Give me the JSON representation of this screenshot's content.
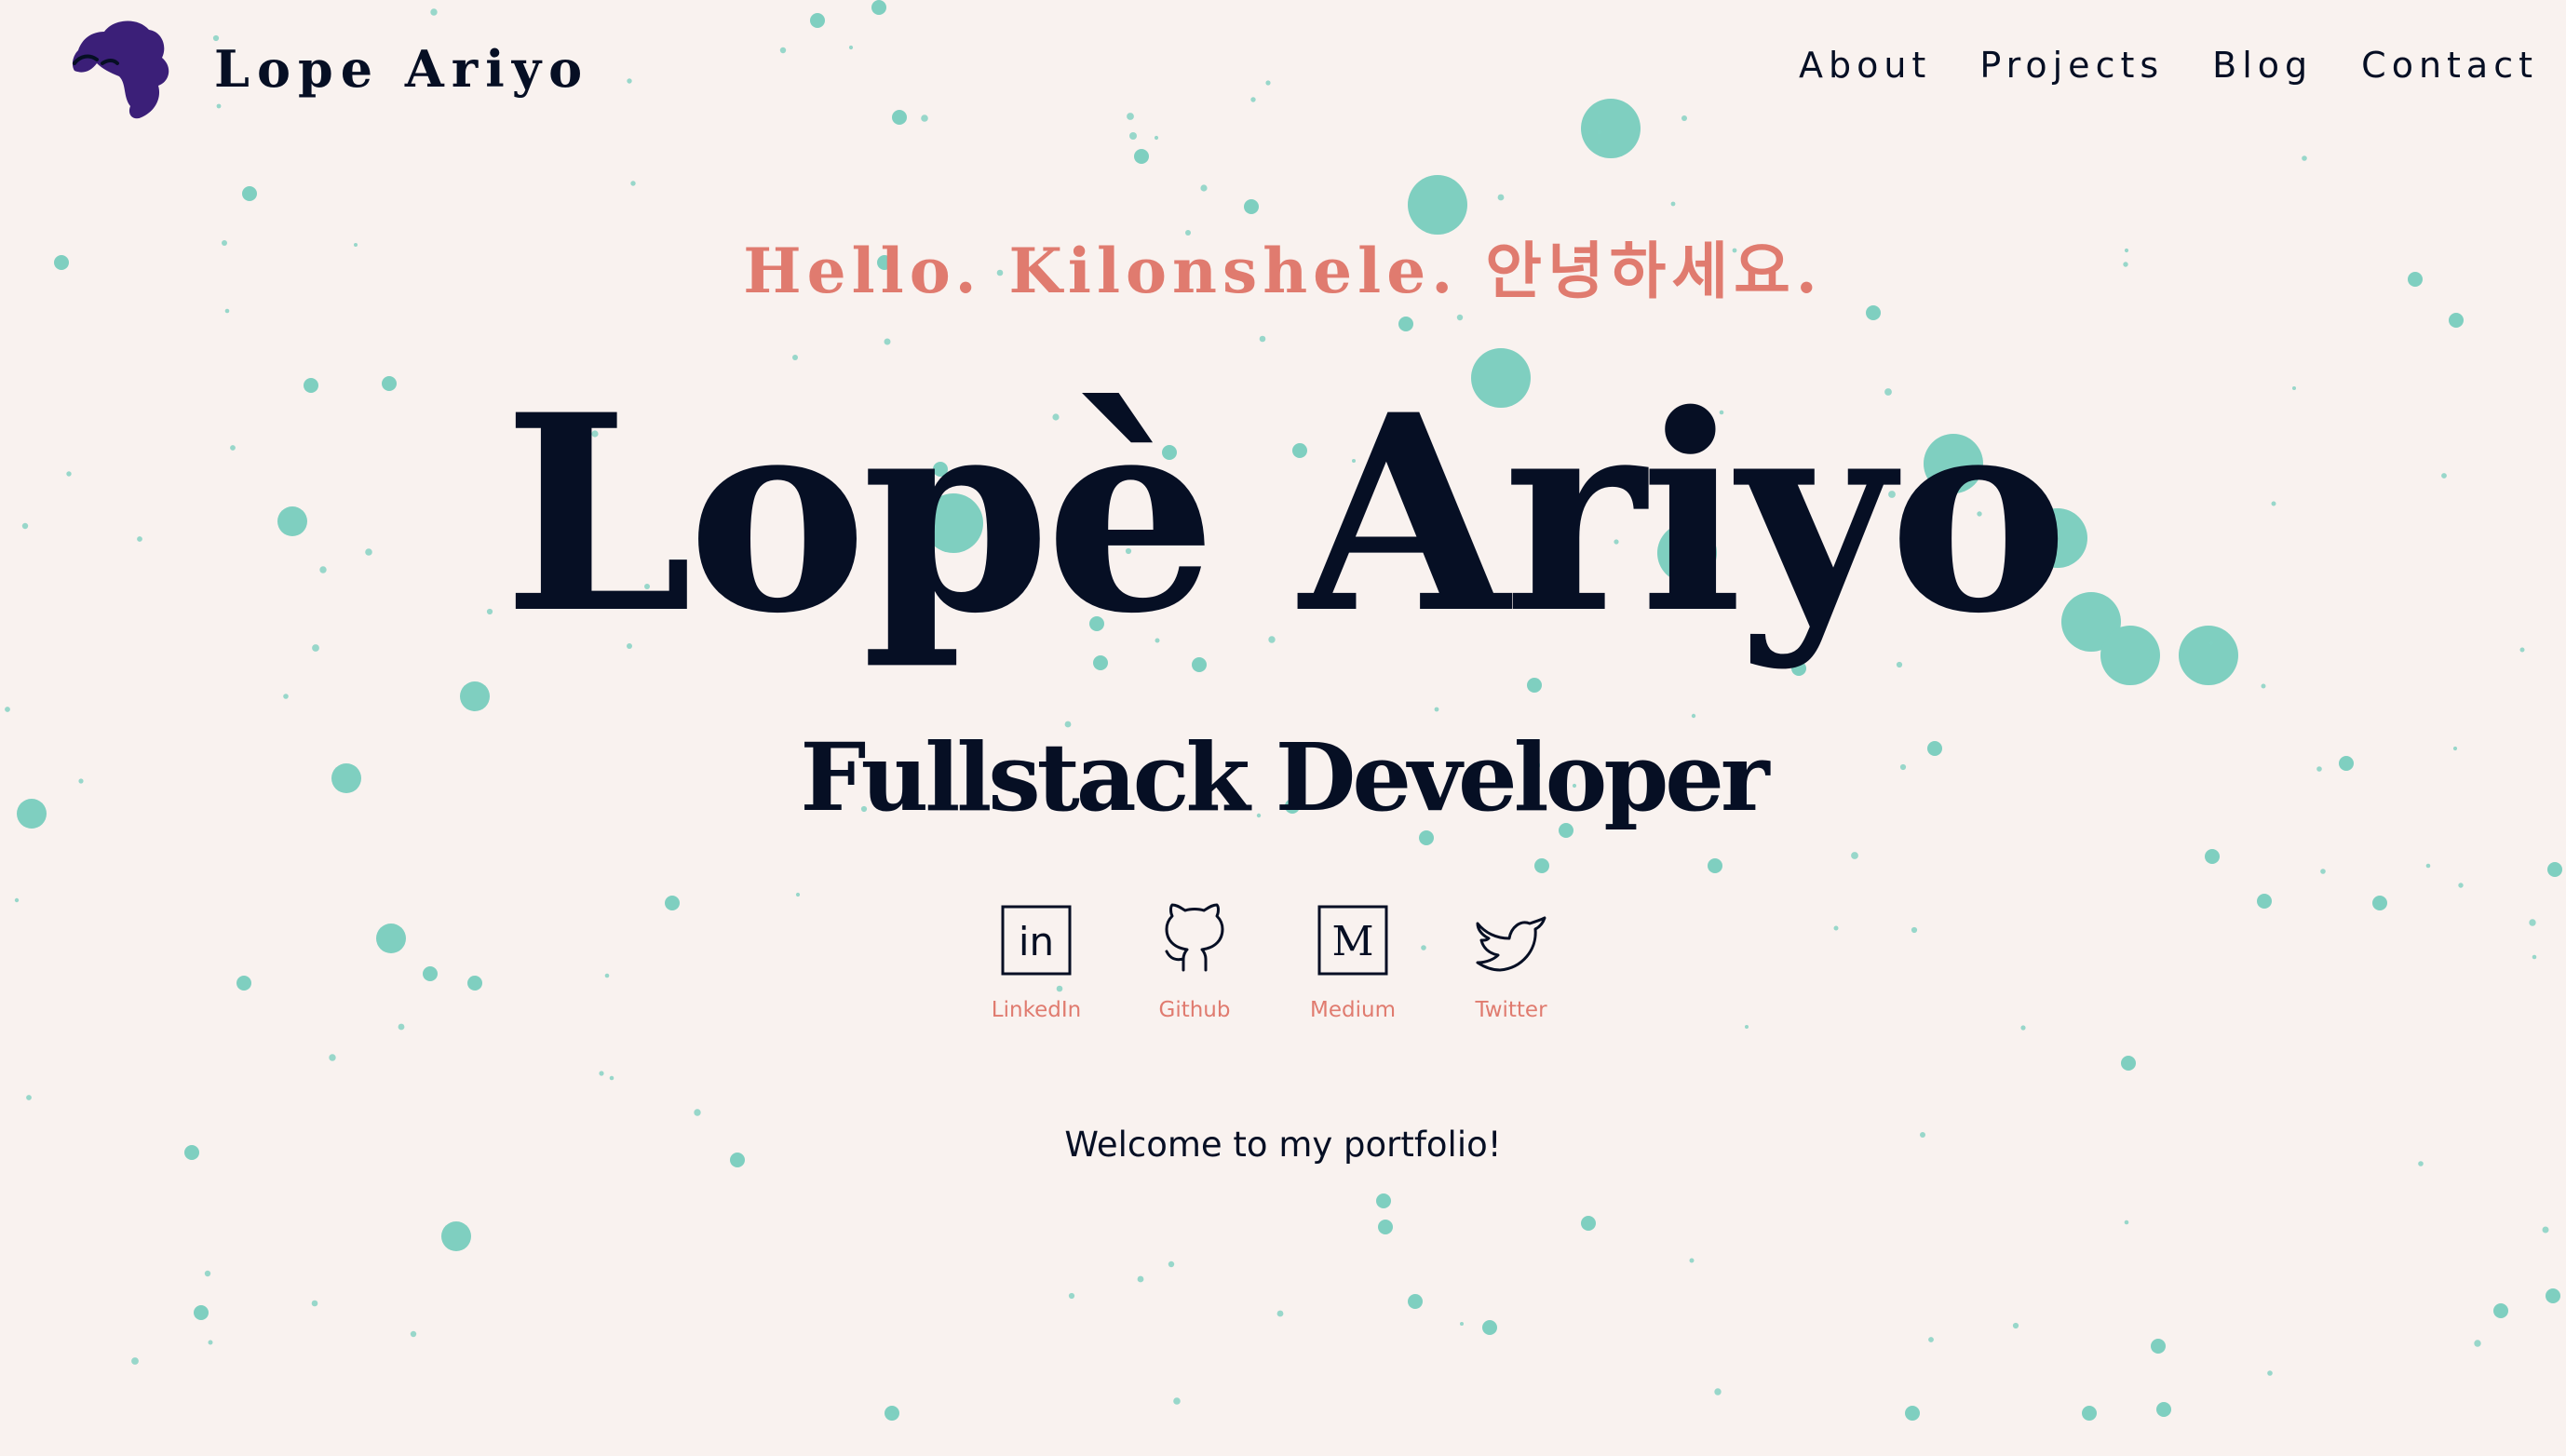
{
  "header": {
    "brand_name": "Lope Ariyo",
    "nav": [
      {
        "label": "About"
      },
      {
        "label": "Projects"
      },
      {
        "label": "Blog"
      },
      {
        "label": "Contact"
      }
    ]
  },
  "hero": {
    "greeting": "Hello. Kilonshele. 안녕하세요.",
    "name": "Lopè Ariyo",
    "role": "Fullstack Developer"
  },
  "socials": [
    {
      "label": "LinkedIn",
      "icon": "linkedin-icon"
    },
    {
      "label": "Github",
      "icon": "github-icon"
    },
    {
      "label": "Medium",
      "icon": "medium-icon"
    },
    {
      "label": "Twitter",
      "icon": "twitter-icon"
    }
  ],
  "welcome": "Welcome to my portfolio!",
  "colors": {
    "background": "#f9f2ef",
    "text": "#060f24",
    "accent": "#e07b6f",
    "particles": "#7fcfc0",
    "logo": "#3b1f78"
  }
}
